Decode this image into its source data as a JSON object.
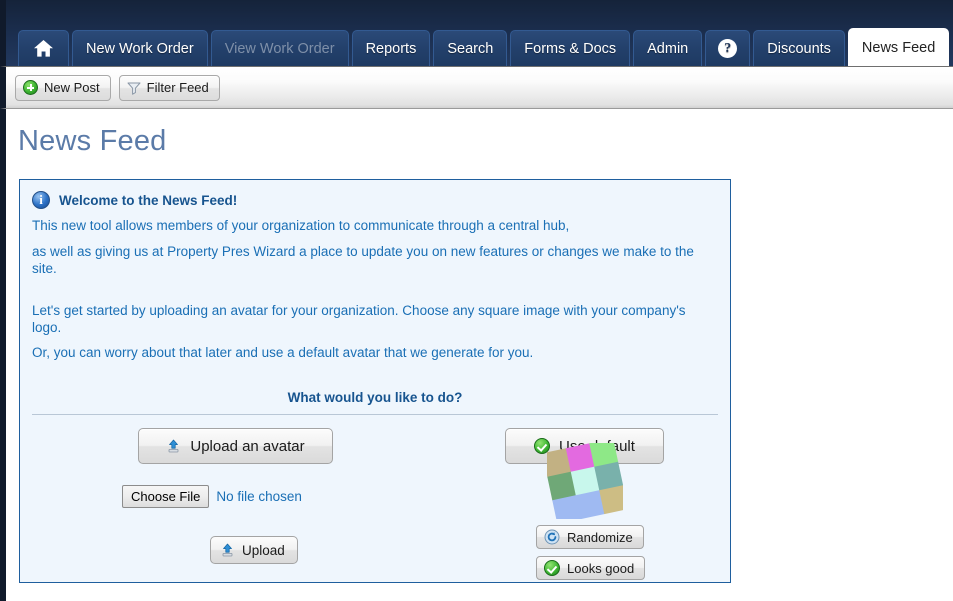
{
  "nav": {
    "tabs": [
      {
        "id": "home",
        "label": "",
        "icon": "home-icon",
        "state": "normal"
      },
      {
        "id": "new-work-order",
        "label": "New Work Order",
        "icon": "",
        "state": "normal"
      },
      {
        "id": "view-work-order",
        "label": "View Work Order",
        "icon": "",
        "state": "disabled"
      },
      {
        "id": "reports",
        "label": "Reports",
        "icon": "",
        "state": "normal"
      },
      {
        "id": "search",
        "label": "Search",
        "icon": "",
        "state": "normal"
      },
      {
        "id": "forms-docs",
        "label": "Forms & Docs",
        "icon": "",
        "state": "normal"
      },
      {
        "id": "admin",
        "label": "Admin",
        "icon": "",
        "state": "normal"
      },
      {
        "id": "help",
        "label": "?",
        "icon": "question-mark-icon",
        "state": "normal"
      },
      {
        "id": "discounts",
        "label": "Discounts",
        "icon": "",
        "state": "normal"
      },
      {
        "id": "news-feed",
        "label": "News Feed",
        "icon": "",
        "state": "active"
      }
    ],
    "colors": {
      "bar_background": "#1c3052",
      "tab_background": "#23406b",
      "active_tab_background": "#ffffff",
      "disabled_label": "#7e8fa8"
    }
  },
  "toolbar": {
    "new_post_label": "New Post",
    "filter_feed_label": "Filter Feed"
  },
  "page": {
    "title": "News Feed"
  },
  "info_box": {
    "heading": "Welcome to the News Feed!",
    "paragraph_1_line_1": "This new tool allows members of your organization to communicate through a central hub,",
    "paragraph_1_line_2": "as well as giving us at Property Pres Wizard a place to update you on new features or changes we make to the site.",
    "paragraph_2_line_1": "Let's get started by uploading an avatar for your organization. Choose any square image with your company's logo.",
    "paragraph_2_line_2": "Or, you can worry about that later and use a default avatar that we generate for you.",
    "prompt": "What would you like to do?",
    "border_color": "#1f5f9e",
    "background_color": "#eff6fd",
    "text_color": "#1a6fb5"
  },
  "actions": {
    "upload_an_avatar_label": "Upload an avatar",
    "use_default_label": "Use default",
    "choose_file_label": "Choose File",
    "no_file_chosen_label": "No file chosen",
    "upload_label": "Upload",
    "randomize_label": "Randomize",
    "looks_good_label": "Looks good"
  },
  "avatar": {
    "description": "generated default identicon avatar — rotated 3x3 grid of pastel squares",
    "rotation_degrees": -12,
    "tiles": [
      [
        "#c2b183",
        "#e36ae0",
        "#8ee887"
      ],
      [
        "#6fa877",
        "#c8f7ec",
        "#79b1ab"
      ],
      [
        "#9fbaf2",
        "#9fbaf2",
        "#cdbd84"
      ]
    ]
  }
}
